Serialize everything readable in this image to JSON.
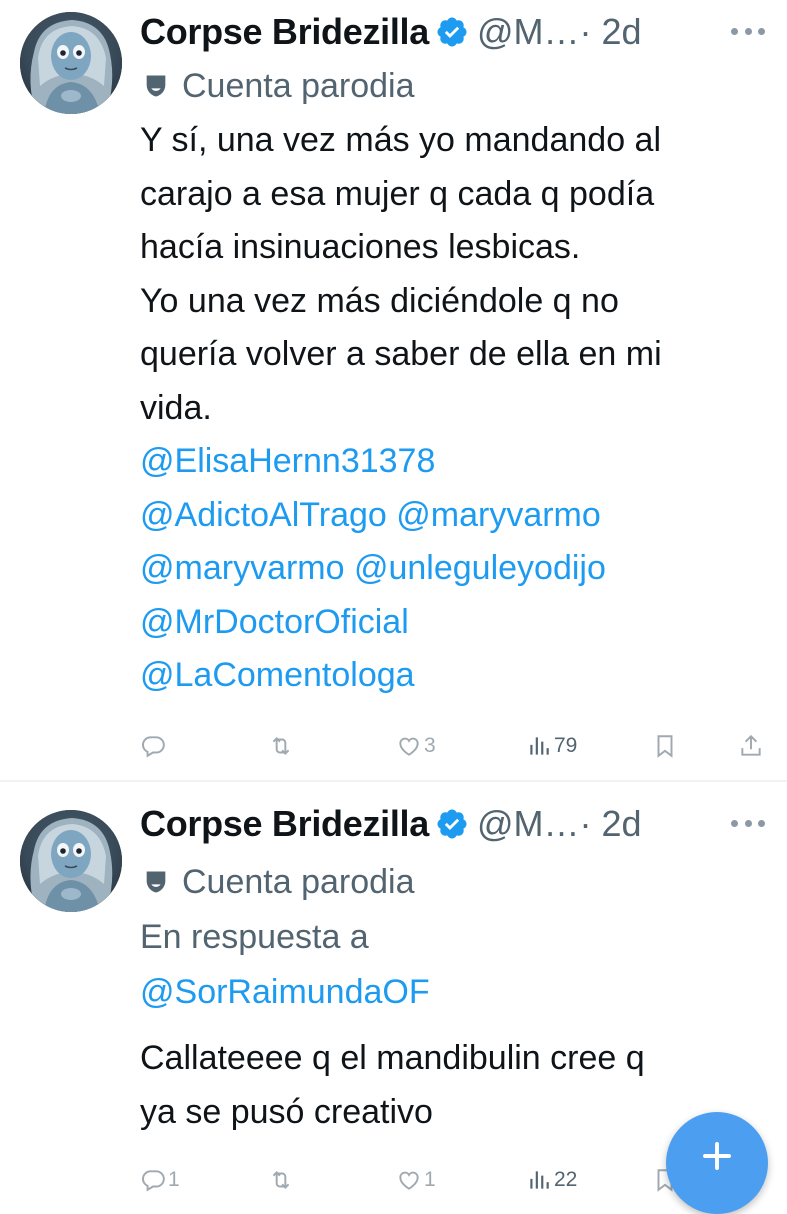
{
  "tweets": [
    {
      "author_name": "Corpse Bridezilla",
      "handle": "@M…",
      "time": "· 2d",
      "parody_label": "Cuenta parodia",
      "text_lines": [
        "Y sí, una vez más yo mandando al",
        "carajo a esa mujer q cada q podía",
        "hacía insinuaciones lesbicas.",
        "Yo una vez más diciéndole q no",
        "quería volver a saber de ella en mi",
        "vida."
      ],
      "mention_lines": [
        "@ElisaHernn31378",
        "@AdictoAlTrago @maryvarmo",
        "@maryvarmo @unleguleyodijo",
        "@MrDoctorOficial",
        "@LaComentologa"
      ],
      "actions": {
        "replies": "",
        "reposts": "",
        "likes": "3",
        "views": "79"
      }
    },
    {
      "author_name": "Corpse Bridezilla",
      "handle": "@M…",
      "time": "· 2d",
      "parody_label": "Cuenta parodia",
      "reply_label": "En respuesta a",
      "reply_to": "@SorRaimundaOF",
      "text_lines": [
        "Callateeee q el mandibulin cree q",
        "ya se pusó creativo"
      ],
      "actions": {
        "replies": "1",
        "reposts": "",
        "likes": "1",
        "views": "22"
      }
    }
  ],
  "colors": {
    "accent": "#1d9bf0",
    "secondary_text": "#536471",
    "fab": "#4c9ff0"
  },
  "icons": {
    "verified": "verified-badge-icon",
    "parody": "parody-mask-icon",
    "more": "more-options-icon",
    "reply": "reply-icon",
    "repost": "repost-icon",
    "like": "like-icon",
    "views": "views-icon",
    "bookmark": "bookmark-icon",
    "share": "share-icon",
    "compose": "compose-plus-icon"
  }
}
